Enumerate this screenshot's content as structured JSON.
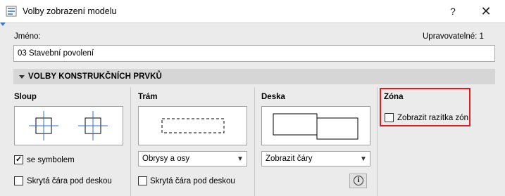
{
  "window": {
    "title": "Volby zobrazení modelu",
    "help_label": "?",
    "close_label": "✕"
  },
  "name_field": {
    "label": "Jméno:",
    "value": "03 Stavební povolení",
    "editable_label": "Upravovatelné: 1"
  },
  "section": {
    "title": "VOLBY KONSTRUKČNÍCH PRVKŮ"
  },
  "columns": {
    "column": {
      "title": "Sloup",
      "symbol_checkbox": {
        "label": "se symbolem",
        "checked": true
      },
      "hidden_line_checkbox": {
        "label": "Skrytá čára pod deskou",
        "checked": false
      }
    },
    "beam": {
      "title": "Trám",
      "dropdown_value": "Obrysy a osy",
      "hidden_line_checkbox": {
        "label": "Skrytá čára pod deskou",
        "checked": false
      }
    },
    "slab": {
      "title": "Deska",
      "dropdown_value": "Zobrazit čáry",
      "info_icon": "info-icon"
    },
    "zone": {
      "title": "Zóna",
      "stamps_checkbox": {
        "label": "Zobrazit razítka zón",
        "checked": false
      }
    }
  },
  "colors": {
    "highlight": "#e31c23",
    "axis_blue": "#2f6fc9",
    "section_bg": "#d6d6d6",
    "dialog_bg": "#ebebeb"
  }
}
